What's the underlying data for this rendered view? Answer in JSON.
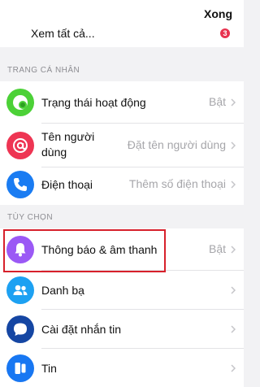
{
  "header": {
    "done_label": "Xong",
    "see_all_label": "Xem tất cả...",
    "badge_count": "3"
  },
  "profile_section": {
    "title": "TRANG CÁ NHÂN",
    "items": [
      {
        "label": "Trạng thái hoạt động",
        "value": "Bật",
        "icon": "active-status-icon",
        "color": "#4cd137"
      },
      {
        "label_line1": "Tên người",
        "label_line2": "dùng",
        "value": "Đặt tên người dùng",
        "icon": "at-sign-icon",
        "color": "#ee3553"
      },
      {
        "label": "Điện thoại",
        "value": "Thêm số điện thoại",
        "icon": "phone-icon",
        "color": "#1a7cf2"
      }
    ]
  },
  "options_section": {
    "title": "TÙY CHỌN",
    "items": [
      {
        "label": "Thông báo & âm thanh",
        "value": "Bật",
        "icon": "bell-icon",
        "color": "#9b59f5"
      },
      {
        "label": "Danh bạ",
        "value": "",
        "icon": "contacts-icon",
        "color": "#1da1f2"
      },
      {
        "label": "Cài đặt nhắn tin",
        "value": "",
        "icon": "chat-bubble-icon",
        "color": "#1546a3"
      },
      {
        "label": "Tin",
        "value": "",
        "icon": "stories-icon",
        "color": "#1877f2"
      }
    ]
  },
  "highlight": {
    "color": "#d7202b"
  }
}
